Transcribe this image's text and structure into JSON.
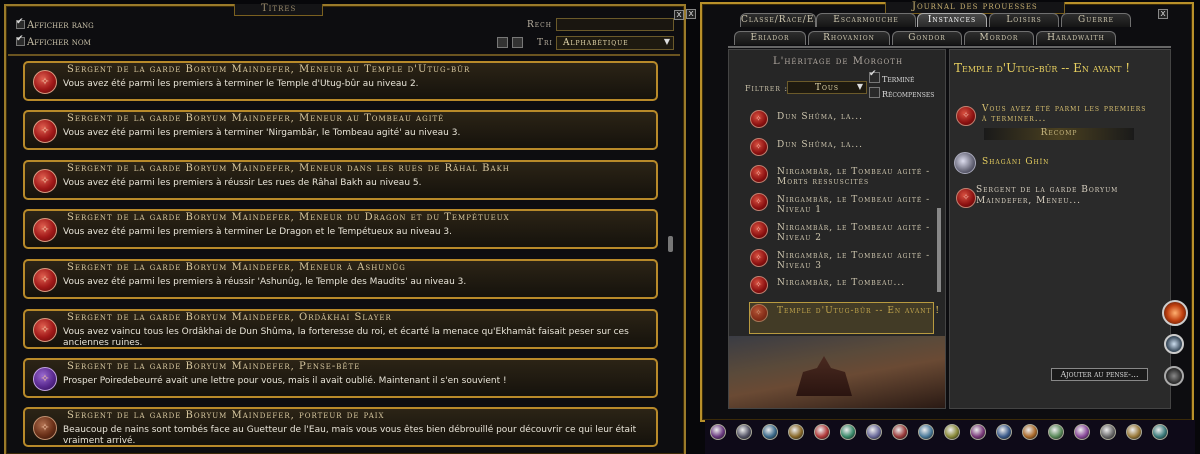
{
  "left_window": {
    "title": "Titres",
    "close": "x",
    "show_rank": "Afficher rang",
    "show_name": "Afficher nom",
    "search_label": "Rech :",
    "search_value": "",
    "sort_label": "Tri :",
    "sort_value": "Alphabétique",
    "rows": [
      {
        "title": "Sergent de la garde Boryum Maindefer, Meneur au Temple d'Utug-bûr",
        "desc": "Vous avez été parmi les premiers à terminer le Temple d'Utug-bûr au niveau 2.",
        "icon": "red-medal-icon"
      },
      {
        "title": "Sergent de la garde Boryum Maindefer, Meneur au Tombeau agité",
        "desc": "Vous avez été parmi les premiers à terminer 'Nirgambâr, le Tombeau agité' au niveau 3.",
        "icon": "red-medal-icon"
      },
      {
        "title": "Sergent de la garde Boryum Maindefer, Meneur dans les rues de Râhal Bakh",
        "desc": "Vous avez été parmi les premiers à réussir Les rues de Râhal Bakh au niveau 5.",
        "icon": "red-medal-icon"
      },
      {
        "title": "Sergent de la garde Boryum Maindefer, Meneur du Dragon et du Tempétueux",
        "desc": "Vous avez été parmi les premiers à terminer Le Dragon et le Tempétueux au niveau 3.",
        "icon": "red-medal-icon"
      },
      {
        "title": "Sergent de la garde Boryum Maindefer, Meneur à Ashunûg",
        "desc": "Vous avez été parmi les premiers à réussir 'Ashunûg, le Temple des Maudits' au niveau 3.",
        "icon": "red-medal-icon"
      },
      {
        "title": "Sergent de la garde Boryum Maindefer, Ordâkhai Slayer",
        "desc": "Vous avez vaincu tous les Ordâkhai de Dun Shûma, la forteresse du roi, et écarté la menace qu'Ekhamât faisait peser sur ces anciennes ruines.",
        "icon": "red-medal-icon"
      },
      {
        "title": "Sergent de la garde Boryum Maindefer, Pense-bête",
        "desc": "Prosper Poiredebeurré avait une lettre pour vous, mais il avait oublié. Maintenant il s'en souvient !",
        "icon": "purple-medal-icon"
      },
      {
        "title": "Sergent de la garde Boryum Maindefer, porteur de paix",
        "desc": "Beaucoup de nains sont tombés face au Guetteur de l'Eau, mais vous vous êtes bien débrouillé pour découvrir ce qui leur était vraiment arrivé.",
        "icon": "brown-medal-icon"
      }
    ]
  },
  "right_window": {
    "title": "Journal des prouesses",
    "close": "x",
    "tabs_row1": [
      "Classe/Race/Epique",
      "Escarmouche",
      "Instances",
      "Loisirs",
      "Guerre"
    ],
    "tabs_row2": [
      "Eriador",
      "Rhovanion",
      "Gondor",
      "Mordor",
      "Haradwaith"
    ],
    "active_tab": "Instances",
    "category_title": "L'héritage de Morgoth",
    "filter_label": "Filtrer :",
    "filter_value": "Tous",
    "check_done": "Terminé",
    "check_rewards": "Récompenses",
    "deeds": [
      "Dun Shûma, la...",
      "Dun Shûma, la...",
      "Nirgambâr, le Tombeau agité - Morts ressuscités",
      "Nirgambâr, le Tombeau agité - Niveau 1",
      "Nirgambâr, le Tombeau agité - Niveau 2",
      "Nirgambâr, le Tombeau agité - Niveau 3",
      "Nirgambâr, le Tombeau...",
      "Temple d'Utug-bûr -- En avant !"
    ],
    "detail": {
      "title": "Temple d'Utug-bûr -- En avant !",
      "objective": "Vous avez été parmi les premiers à terminer...",
      "reward_label": "Recomp",
      "reward1": "Shagâni Ghîn",
      "reward2": "Sergent de la garde Boryum Maindefer, Meneu...",
      "add_button": "Ajouter au pense-..."
    }
  },
  "colors": {
    "gold_border": "#b88a2a",
    "row_bg": "#221c12",
    "detail_title": "#e8d060"
  }
}
